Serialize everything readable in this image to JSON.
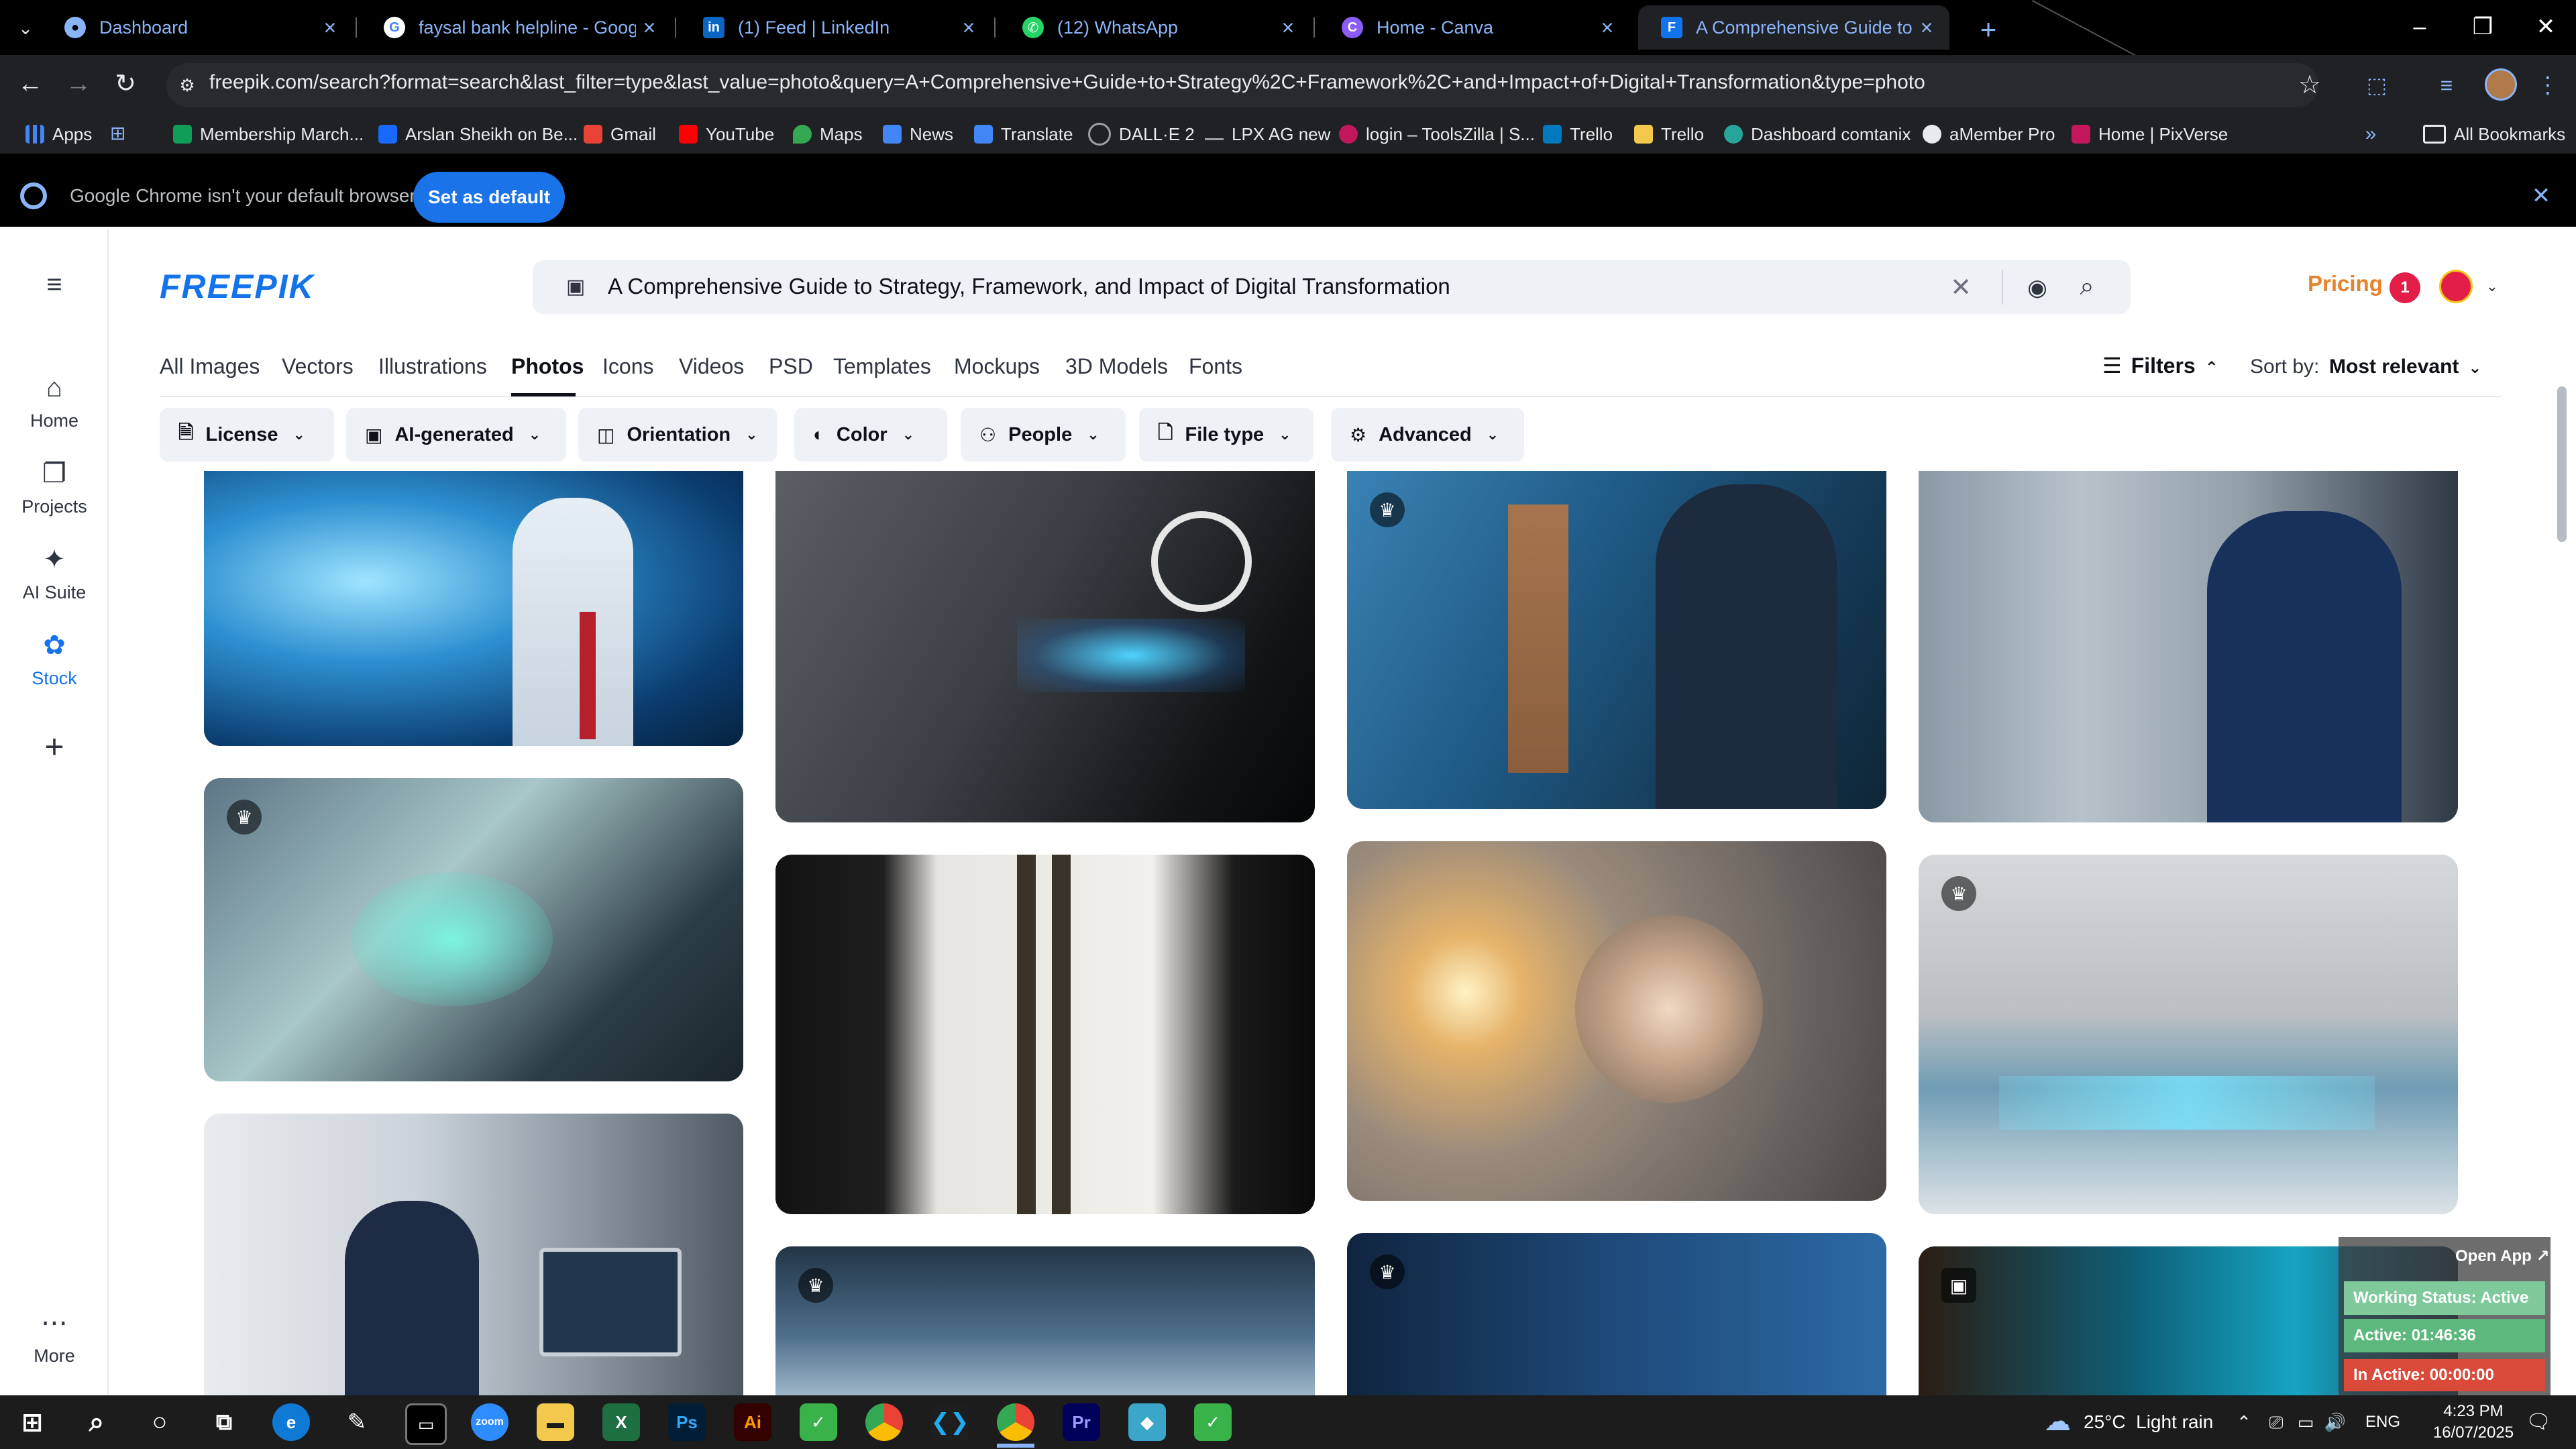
{
  "browser": {
    "tabs": [
      {
        "title": "Dashboard",
        "icon": "chrome-icon",
        "color": "#8ab4f8"
      },
      {
        "title": "faysal bank helpline - Google S",
        "icon": "google-icon",
        "color": "#ffffff"
      },
      {
        "title": "(1) Feed | LinkedIn",
        "icon": "linkedin-icon",
        "color": "#0a66c2"
      },
      {
        "title": "(12) WhatsApp",
        "icon": "whatsapp-icon",
        "color": "#25d366"
      },
      {
        "title": "Home - Canva",
        "icon": "canva-icon",
        "color": "#8b5cf6"
      },
      {
        "title": "A Comprehensive Guide to Stra",
        "icon": "freepik-icon",
        "color": "#1273eb"
      }
    ],
    "url": "freepik.com/search?format=search&last_filter=type&last_value=photo&query=A+Comprehensive+Guide+to+Strategy%2C+Framework%2C+and+Impact+of+Digital+Transformation&type=photo",
    "bookmarks": [
      {
        "label": "Apps",
        "color": "#4285f4"
      },
      {
        "label": "Membership March...",
        "color": "#0f9d58"
      },
      {
        "label": "Arslan Sheikh on Be...",
        "color": "#1769ff"
      },
      {
        "label": "Gmail",
        "color": "#ea4335"
      },
      {
        "label": "YouTube",
        "color": "#ff0000"
      },
      {
        "label": "Maps",
        "color": "#34a853"
      },
      {
        "label": "News",
        "color": "#4285f4"
      },
      {
        "label": "Translate",
        "color": "#4285f4"
      },
      {
        "label": "DALL·E 2",
        "color": "#9aa0a6"
      },
      {
        "label": "LPX AG new",
        "color": "#9aa0a6"
      },
      {
        "label": "login – ToolsZilla | S...",
        "color": "#c2185b"
      },
      {
        "label": "Trello",
        "color": "#0079bf"
      },
      {
        "label": "Trello",
        "color": "#f2c94c"
      },
      {
        "label": "Dashboard comtanix",
        "color": "#26a69a"
      },
      {
        "label": "aMember Pro",
        "color": "#e8eaed"
      },
      {
        "label": "Home | PixVerse",
        "color": "#c2185b"
      }
    ],
    "all_bookmarks": "All Bookmarks",
    "banner_text": "Google Chrome isn't your default browser",
    "banner_button": "Set as default"
  },
  "sidebar": {
    "items": [
      {
        "label": "Home",
        "icon": "home-icon"
      },
      {
        "label": "Projects",
        "icon": "projects-icon"
      },
      {
        "label": "AI Suite",
        "icon": "sparkle-icon"
      },
      {
        "label": "Stock",
        "icon": "stock-icon"
      }
    ],
    "more": "More"
  },
  "header": {
    "logo": "FREEPIK",
    "search_query": "A Comprehensive Guide to Strategy, Framework, and Impact of Digital Transformation",
    "pricing": "Pricing",
    "notification_count": "1"
  },
  "nav": {
    "tabs": [
      "All Images",
      "Vectors",
      "Illustrations",
      "Photos",
      "Icons",
      "Videos",
      "PSD",
      "Templates",
      "Mockups",
      "3D Models",
      "Fonts"
    ],
    "active": "Photos",
    "filters_label": "Filters",
    "sort_label": "Sort by:",
    "sort_value": "Most relevant"
  },
  "filter_chips": [
    "License",
    "AI-generated",
    "Orientation",
    "Color",
    "People",
    "File type",
    "Advanced"
  ],
  "widget": {
    "open_app": "Open App ↗",
    "status": "Working Status: Active",
    "active": "Active: 01:46:36",
    "inactive": "In Active: 00:00:00"
  },
  "taskbar": {
    "weather": "25°C  Light rain",
    "lang": "ENG",
    "time": "4:23 PM",
    "date": "16/07/2025"
  }
}
